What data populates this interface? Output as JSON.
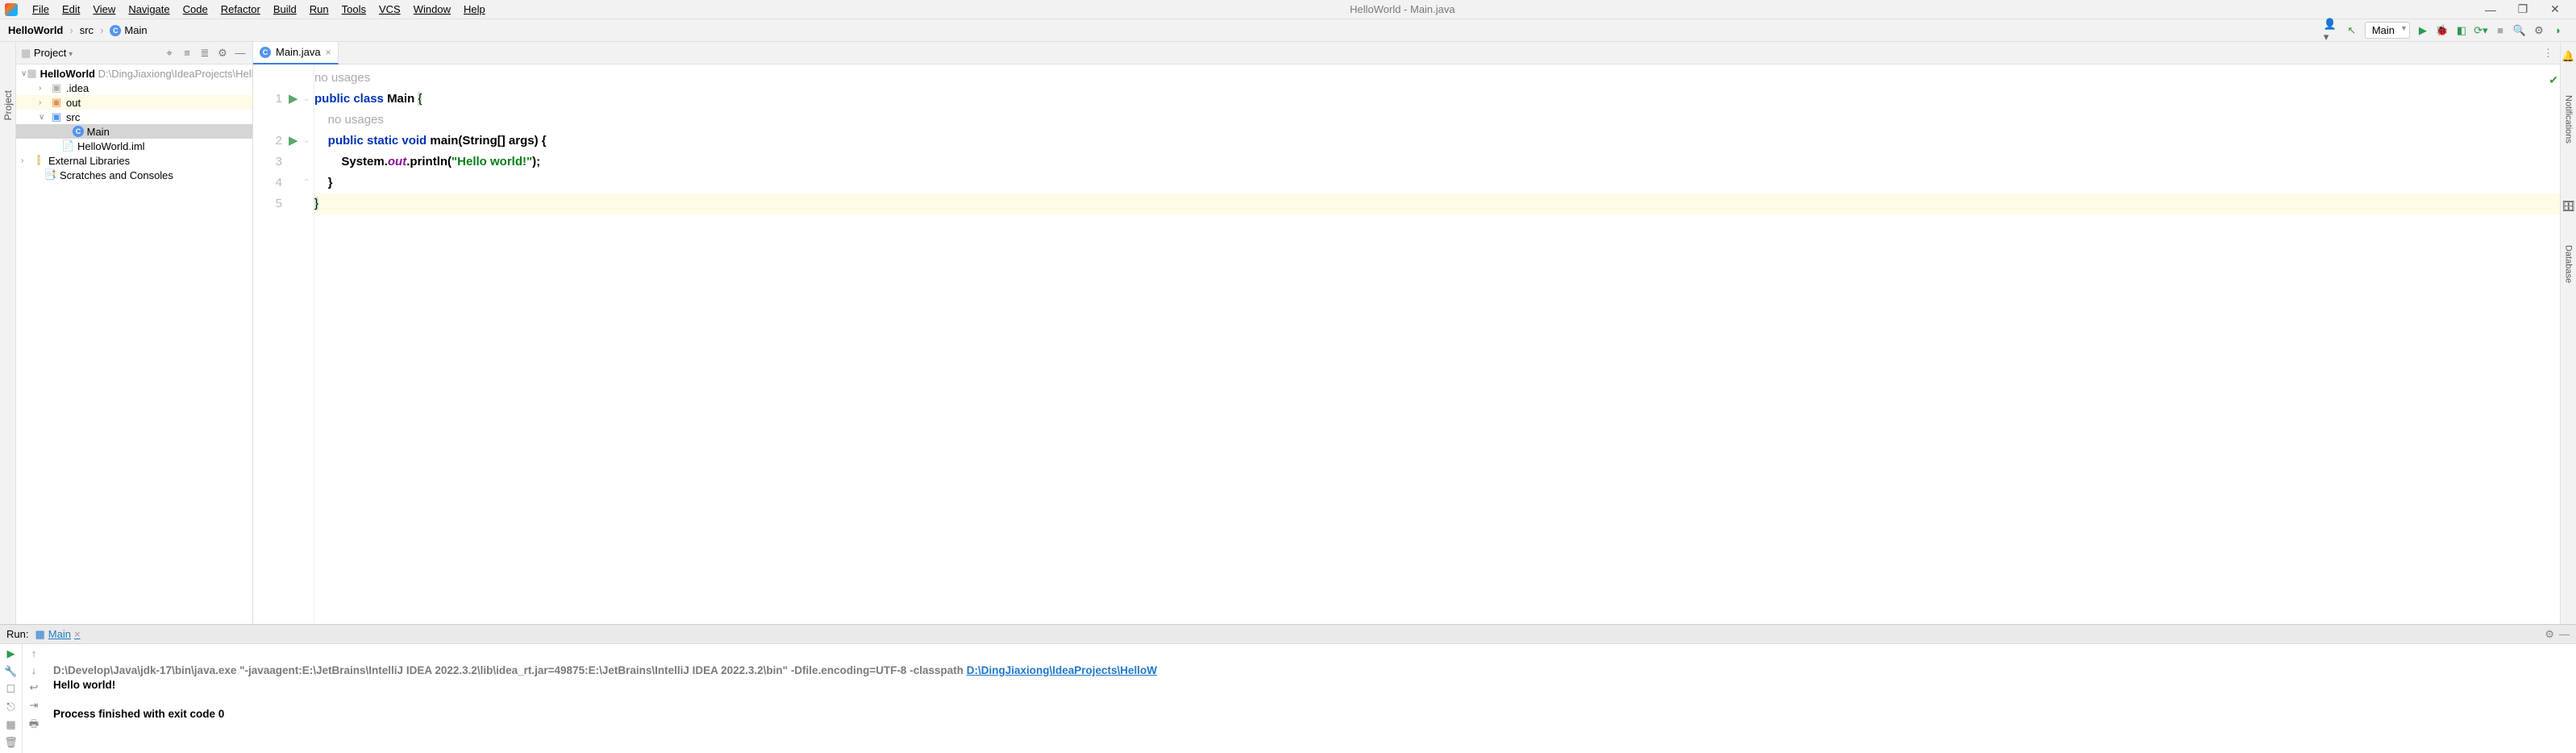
{
  "window": {
    "title": "HelloWorld - Main.java"
  },
  "menu": {
    "file": "File",
    "edit": "Edit",
    "view": "View",
    "navigate": "Navigate",
    "code": "Code",
    "refactor": "Refactor",
    "build": "Build",
    "run": "Run",
    "tools": "Tools",
    "vcs": "VCS",
    "window": "Window",
    "help": "Help"
  },
  "breadcrumb": {
    "root": "HelloWorld",
    "src": "src",
    "file": "Main"
  },
  "toolbar": {
    "config": "Main"
  },
  "project_tool": {
    "title": "Project"
  },
  "left_gutter": {
    "label": "Project"
  },
  "right_gutter": {
    "notifications": "Notifications",
    "database": "Database"
  },
  "tree": {
    "root_name": "HelloWorld",
    "root_path": "D:\\DingJiaxiong\\IdeaProjects\\HelloWor",
    "idea": ".idea",
    "out": "out",
    "src": "src",
    "main": "Main",
    "iml": "HelloWorld.iml",
    "ext": "External Libraries",
    "scr": "Scratches and Consoles"
  },
  "editor_tab": {
    "name": "Main.java"
  },
  "code": {
    "hint1": "no usages",
    "l1_a": "public",
    "l1_b": "class",
    "l1_c": "Main",
    "l1_d": "{",
    "hint2": "no usages",
    "l2_a": "public",
    "l2_b": "static",
    "l2_c": "void",
    "l2_d": "main",
    "l2_e": "(String[] args) {",
    "l3_a": "System.",
    "l3_b": "out",
    "l3_c": ".println(",
    "l3_d": "\"Hello world!\"",
    "l3_e": ");",
    "l4": "}",
    "l5": "}"
  },
  "line_no": {
    "n1": "1",
    "n2": "2",
    "n3": "3",
    "n4": "4",
    "n5": "5"
  },
  "run": {
    "label": "Run:",
    "tab": "Main",
    "cmd": "D:\\Develop\\Java\\jdk-17\\bin\\java.exe \"-javaagent:E:\\JetBrains\\IntelliJ IDEA 2022.3.2\\lib\\idea_rt.jar=49875:E:\\JetBrains\\IntelliJ IDEA 2022.3.2\\bin\" -Dfile.encoding=UTF-8 -classpath ",
    "cmd_link": "D:\\DingJiaxiong\\IdeaProjects\\HelloW",
    "out": "Hello world!",
    "exit": "Process finished with exit code 0"
  }
}
